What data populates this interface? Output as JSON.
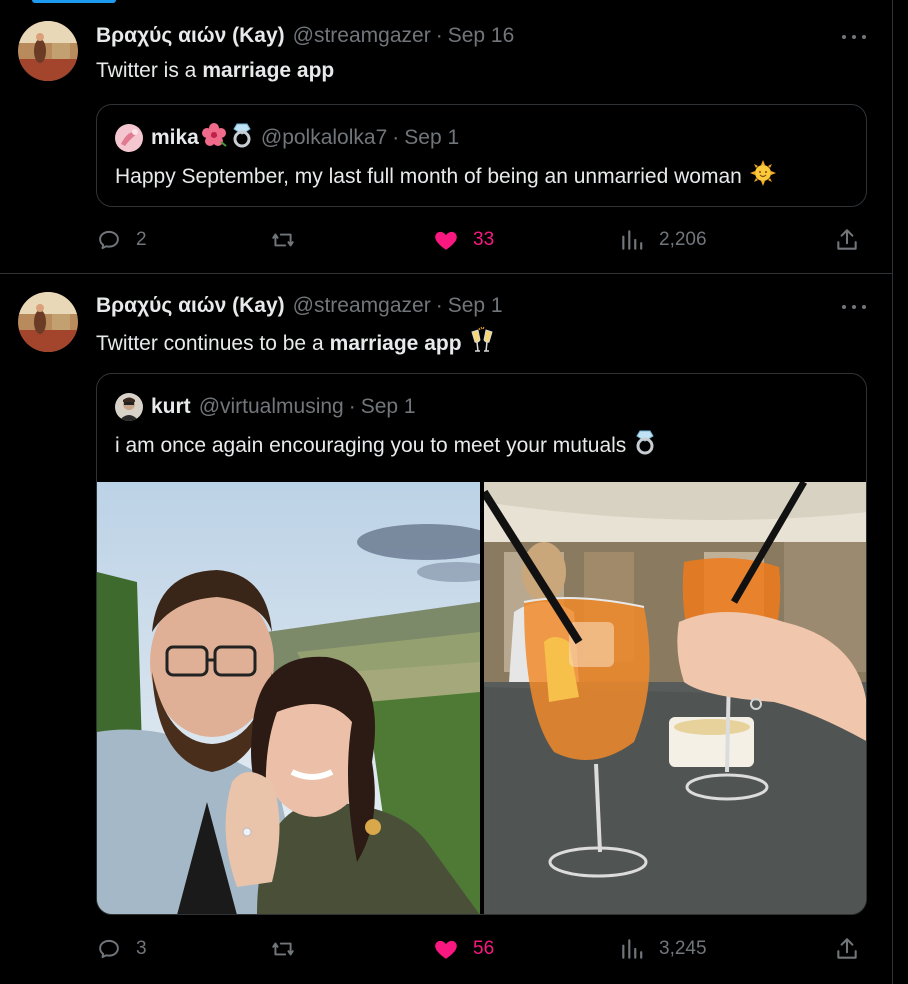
{
  "tweets": [
    {
      "author_name": "Βραχύς αιών (Kay)",
      "author_handle": "@streamgazer",
      "date": "Sep 16",
      "text_plain": "Twitter is a",
      "text_bold": "marriage app",
      "quote": {
        "name": "mika",
        "handle": "@polkalolka7",
        "date": "Sep 1",
        "text": "Happy September, my last full month of being an unmarried woman"
      },
      "replies": "2",
      "retweets": "",
      "likes": "33",
      "views": "2,206"
    },
    {
      "author_name": "Βραχύς αιών (Kay)",
      "author_handle": "@streamgazer",
      "date": "Sep 1",
      "text_plain": "Twitter continues to be a",
      "text_bold": "marriage app",
      "quote": {
        "name": "kurt",
        "handle": "@virtualmusing",
        "date": "Sep 1",
        "text": "i am once again encouraging you to meet your mutuals"
      },
      "replies": "3",
      "retweets": "",
      "likes": "56",
      "views": "3,245"
    }
  ],
  "separator": "·",
  "icons": {
    "reply": "reply-icon",
    "retweet": "retweet-icon",
    "like": "heart-icon",
    "views": "views-icon",
    "share": "share-icon",
    "more": "more-icon"
  },
  "colors": {
    "background": "#000000",
    "text": "#e7e9ea",
    "muted": "#71767b",
    "like": "#f91880",
    "border": "#2f3336",
    "accent": "#1d9bf0"
  }
}
